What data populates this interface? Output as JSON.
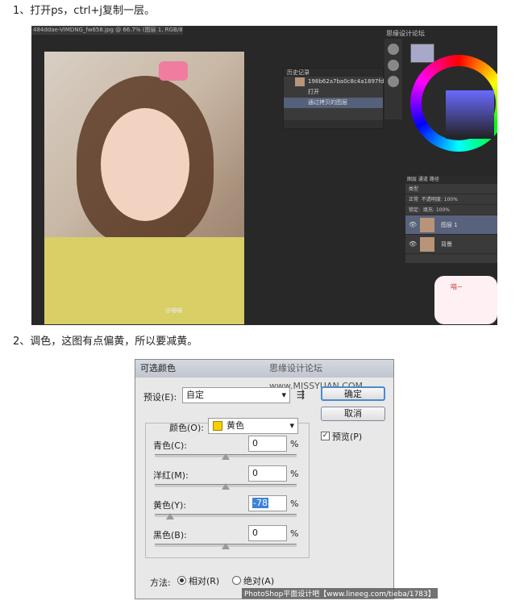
{
  "steps": {
    "step1": "1、打开ps，ctrl+j复制一层。",
    "step2": "2、调色，这图有点偏黄，所以要减黄。"
  },
  "ps": {
    "tab_title": "484ddae-VIMDNG_fw658.jpg @ 66.7% (图层 1, RGB/8#) *",
    "watermark": "思缘设计论坛",
    "photo_watermark": "@喵喵",
    "history": {
      "title": "历史记录",
      "snapshot": "198b62a7ba0c8c4a1897fd...",
      "items": [
        "打开",
        "通过拷贝的图层"
      ]
    },
    "layers": {
      "tabs": "图层  通道  路径",
      "kind": "类型",
      "blend": "正常",
      "opacity_label": "不透明度:",
      "opacity": "100%",
      "lock_label": "锁定:",
      "fill_label": "填充:",
      "fill": "100%",
      "rows": [
        {
          "name": "图层 1",
          "selected": true
        },
        {
          "name": "背景",
          "selected": false
        }
      ]
    },
    "sticker_text": "喵~"
  },
  "dialog": {
    "title": "可选颜色",
    "watermark": "思缘设计论坛 www.MISSYUAN.COM",
    "preset_label": "预设(E):",
    "preset_value": "自定",
    "colors_label": "颜色(O):",
    "colors_value": "黄色",
    "ok": "确定",
    "cancel": "取消",
    "preview": "预览(P)",
    "sliders": [
      {
        "label": "青色(C):",
        "value": "0",
        "pos": 0.5
      },
      {
        "label": "洋红(M):",
        "value": "0",
        "pos": 0.5
      },
      {
        "label": "黄色(Y):",
        "value": "-78",
        "pos": 0.11
      },
      {
        "label": "黑色(B):",
        "value": "0",
        "pos": 0.5
      }
    ],
    "pct": "%",
    "method_label": "方法:",
    "relative": "相对(R)",
    "absolute": "绝对(A)"
  },
  "footer": "PhotoShop平面设计吧【www.lineeg.com/tieba/1783】",
  "colors": {
    "accent": "#3b82d8",
    "yellow_swatch": "#f5d000"
  }
}
